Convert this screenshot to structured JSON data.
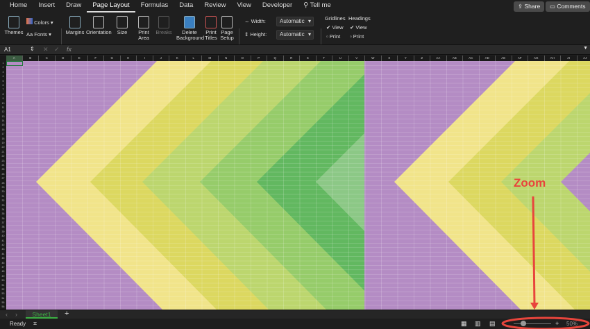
{
  "ribbon_tabs": [
    "Home",
    "Insert",
    "Draw",
    "Page Layout",
    "Formulas",
    "Data",
    "Review",
    "View",
    "Developer"
  ],
  "active_tab": "Page Layout",
  "tell_me": "Tell me",
  "share": "Share",
  "comments": "Comments",
  "ribbon": {
    "themes": "Themes",
    "colors": "Colors",
    "fonts": "Fonts",
    "margins": "Margins",
    "orientation": "Orientation",
    "size": "Size",
    "print_area": "Print Area",
    "breaks": "Breaks",
    "delete_background": "Delete Background",
    "print_titles": "Print Titles",
    "page_setup": "Page Setup",
    "width_label": "Width:",
    "width_value": "Automatic",
    "height_label": "Height:",
    "height_value": "Automatic",
    "gridlines": "Gridlines",
    "headings": "Headings",
    "view": "View",
    "print": "Print",
    "gridlines_view_checked": true,
    "gridlines_print_checked": false,
    "headings_view_checked": true,
    "headings_print_checked": false
  },
  "name_box": "A1",
  "fx": "fx",
  "columns": [
    "A",
    "B",
    "C",
    "D",
    "E",
    "F",
    "G",
    "H",
    "I",
    "J",
    "K",
    "L",
    "M",
    "N",
    "O",
    "P",
    "Q",
    "R",
    "S",
    "T",
    "U",
    "V",
    "W",
    "X",
    "Y",
    "Z",
    "AA",
    "AB",
    "AC",
    "AD",
    "AE",
    "AF",
    "AG",
    "AH",
    "AI",
    "AJ"
  ],
  "sheet_tab": "Sheet1",
  "status": "Ready",
  "annotation": "Zoom",
  "zoom_level": "50%",
  "colors": {
    "purple": "#b48cc4",
    "yellow": "#efe07a",
    "annotation": "#e8453c",
    "sheet_tab": "#3cb043"
  }
}
